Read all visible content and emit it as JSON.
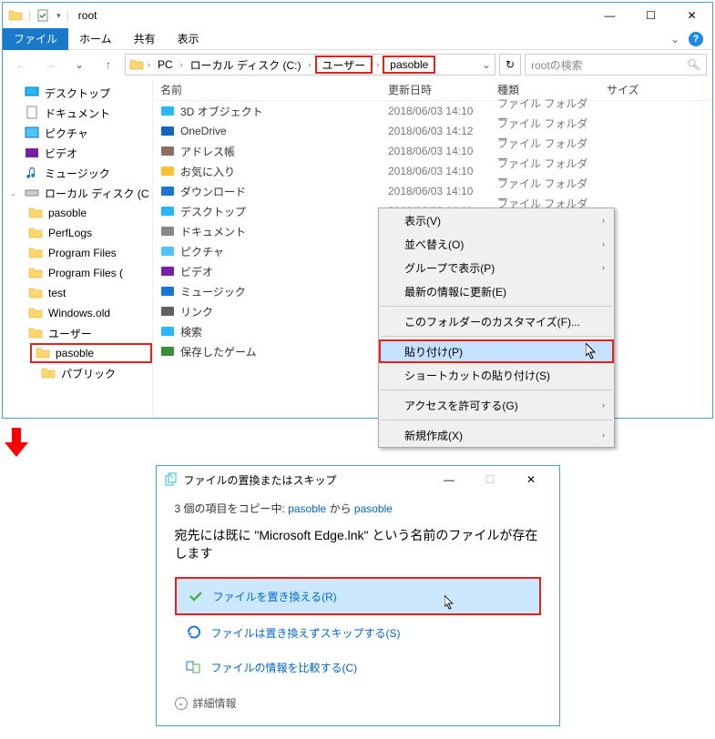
{
  "window": {
    "title": "root",
    "min": "—",
    "max": "☐",
    "close": "✕"
  },
  "ribbon": {
    "file": "ファイル",
    "home": "ホーム",
    "share": "共有",
    "view": "表示"
  },
  "nav": {
    "chevdown": "⌄"
  },
  "breadcrumbs": {
    "pc": "PC",
    "drive": "ローカル ディスク (C:)",
    "users": "ユーザー",
    "pasoble": "pasoble"
  },
  "search": {
    "placeholder": "rootの検索"
  },
  "tree": {
    "desktop": "デスクトップ",
    "documents": "ドキュメント",
    "pictures": "ピクチャ",
    "videos": "ビデオ",
    "music": "ミュージック",
    "localdisk": "ローカル ディスク (C",
    "pasoble": "pasoble",
    "perflogs": "PerfLogs",
    "programfiles": "Program Files",
    "programfilesx": "Program Files (",
    "test": "test",
    "windowsold": "Windows.old",
    "users": "ユーザー",
    "pasoble2": "pasoble",
    "public": "パブリック"
  },
  "columns": {
    "name": "名前",
    "date": "更新日時",
    "type": "種類",
    "size": "サイズ"
  },
  "rows": [
    {
      "name": "3D オブジェクト",
      "date": "2018/06/03 14:10",
      "type": "ファイル フォルダー"
    },
    {
      "name": "OneDrive",
      "date": "2018/06/03 14:12",
      "type": "ファイル フォルダー"
    },
    {
      "name": "アドレス帳",
      "date": "2018/06/03 14:10",
      "type": "ファイル フォルダー"
    },
    {
      "name": "お気に入り",
      "date": "2018/06/03 14:10",
      "type": "ファイル フォルダー"
    },
    {
      "name": "ダウンロード",
      "date": "2018/06/03 14:10",
      "type": "ファイル フォルダー"
    },
    {
      "name": "デスクトップ",
      "date": "2018/06/03 14:11",
      "type": "ファイル フォルダー"
    },
    {
      "name": "ドキュメント",
      "date": "",
      "type": ""
    },
    {
      "name": "ピクチャ",
      "date": "",
      "type": ""
    },
    {
      "name": "ビデオ",
      "date": "",
      "type": ""
    },
    {
      "name": "ミュージック",
      "date": "",
      "type": ""
    },
    {
      "name": "リンク",
      "date": "",
      "type": ""
    },
    {
      "name": "検索",
      "date": "",
      "type": ""
    },
    {
      "name": "保存したゲーム",
      "date": "",
      "type": ""
    }
  ],
  "context_menu": {
    "view": "表示(V)",
    "sort": "並べ替え(O)",
    "group": "グループで表示(P)",
    "refresh": "最新の情報に更新(E)",
    "customize": "このフォルダーのカスタマイズ(F)...",
    "paste": "貼り付け(P)",
    "paste_shortcut": "ショートカットの貼り付け(S)",
    "access": "アクセスを許可する(G)",
    "new": "新規作成(X)"
  },
  "dialog": {
    "title": "ファイルの置換またはスキップ",
    "copying_prefix": "3 個の項目をコピー中: ",
    "from": "pasoble",
    "middle": " から ",
    "to": "pasoble",
    "message": "宛先には既に \"Microsoft Edge.lnk\" という名前のファイルが存在します",
    "replace": "ファイルを置き換える(R)",
    "skip": "ファイルは置き換えずスキップする(S)",
    "compare": "ファイルの情報を比較する(C)",
    "details": "詳細情報"
  }
}
